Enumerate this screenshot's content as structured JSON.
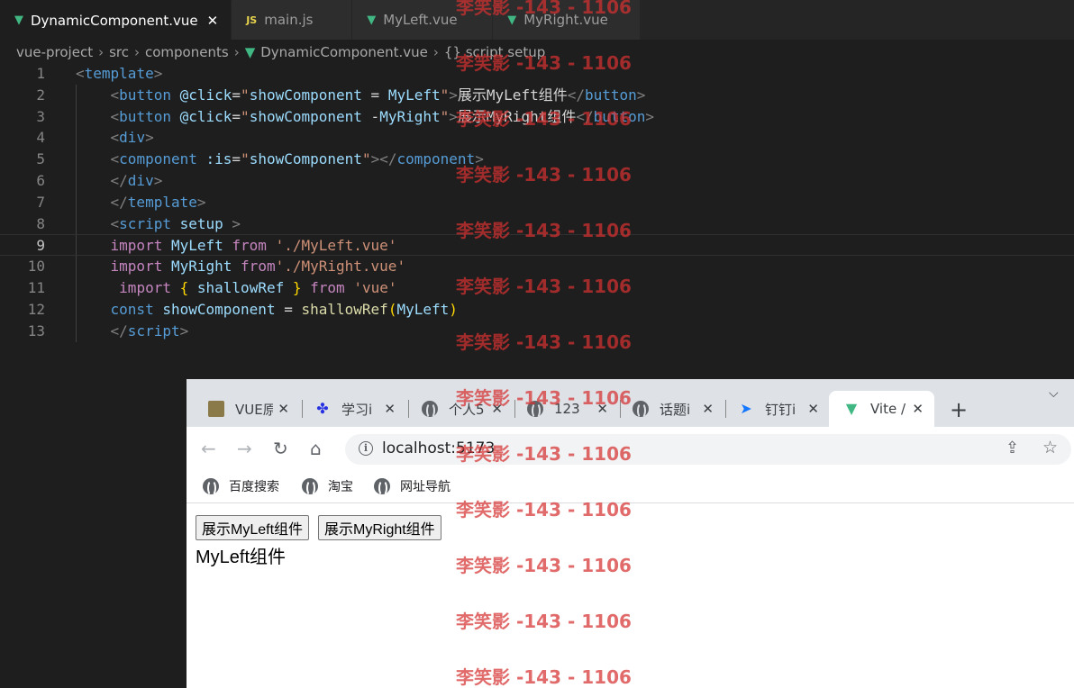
{
  "editor": {
    "tabs": [
      {
        "label": "DynamicComponent.vue",
        "icon": "vue-icon",
        "active": true,
        "close": "✕"
      },
      {
        "label": "main.js",
        "icon": "js-icon",
        "active": false
      },
      {
        "label": "MyLeft.vue",
        "icon": "vue-icon",
        "active": false
      },
      {
        "label": "MyRight.vue",
        "icon": "vue-icon",
        "active": false
      }
    ],
    "js_badge": "JS",
    "breadcrumb": [
      "vue-project",
      "src",
      "components",
      "DynamicComponent.vue",
      "{} script setup"
    ],
    "current_line": 9,
    "lines": [
      {
        "no": "1",
        "tokens": [
          [
            "br",
            "<"
          ],
          [
            "tag",
            "template"
          ],
          [
            "br",
            ">"
          ]
        ]
      },
      {
        "no": "2",
        "tokens": [
          [
            "txt",
            "    "
          ],
          [
            "br",
            "<"
          ],
          [
            "tag",
            "button"
          ],
          [
            "txt",
            " "
          ],
          [
            "attr",
            "@click"
          ],
          [
            "txt",
            "="
          ],
          [
            "str",
            "\""
          ],
          [
            "attr",
            "showComponent"
          ],
          [
            "txt",
            " = "
          ],
          [
            "attr",
            "MyLeft"
          ],
          [
            "str",
            "\""
          ],
          [
            "br",
            ">"
          ],
          [
            "txt",
            "展示MyLeft组件"
          ],
          [
            "br",
            "</"
          ],
          [
            "tag",
            "button"
          ],
          [
            "br",
            ">"
          ]
        ]
      },
      {
        "no": "3",
        "tokens": [
          [
            "txt",
            "    "
          ],
          [
            "br",
            "<"
          ],
          [
            "tag",
            "button"
          ],
          [
            "txt",
            " "
          ],
          [
            "attr",
            "@click"
          ],
          [
            "txt",
            "="
          ],
          [
            "str",
            "\""
          ],
          [
            "attr",
            "showComponent"
          ],
          [
            "txt",
            " -"
          ],
          [
            "attr",
            "MyRight"
          ],
          [
            "str",
            "\""
          ],
          [
            "br",
            ">"
          ],
          [
            "txt",
            "展示MyRight组件"
          ],
          [
            "br",
            "</"
          ],
          [
            "tag",
            "button"
          ],
          [
            "br",
            ">"
          ]
        ]
      },
      {
        "no": "4",
        "tokens": [
          [
            "txt",
            "    "
          ],
          [
            "br",
            "<"
          ],
          [
            "tag",
            "div"
          ],
          [
            "br",
            ">"
          ]
        ]
      },
      {
        "no": "5",
        "tokens": [
          [
            "txt",
            "    "
          ],
          [
            "br",
            "<"
          ],
          [
            "tag",
            "component"
          ],
          [
            "txt",
            " "
          ],
          [
            "attr",
            ":is"
          ],
          [
            "txt",
            "="
          ],
          [
            "str",
            "\""
          ],
          [
            "attr",
            "showComponent"
          ],
          [
            "str",
            "\""
          ],
          [
            "br",
            "></"
          ],
          [
            "tag",
            "component"
          ],
          [
            "br",
            ">"
          ]
        ]
      },
      {
        "no": "6",
        "tokens": [
          [
            "txt",
            "    "
          ],
          [
            "br",
            "</"
          ],
          [
            "tag",
            "div"
          ],
          [
            "br",
            ">"
          ]
        ]
      },
      {
        "no": "7",
        "tokens": [
          [
            "txt",
            "    "
          ],
          [
            "br",
            "</"
          ],
          [
            "tag",
            "template"
          ],
          [
            "br",
            ">"
          ]
        ]
      },
      {
        "no": "8",
        "tokens": [
          [
            "txt",
            "    "
          ],
          [
            "br",
            "<"
          ],
          [
            "tag",
            "script"
          ],
          [
            "txt",
            " "
          ],
          [
            "attr",
            "setup"
          ],
          [
            "txt",
            " "
          ],
          [
            "br",
            ">"
          ]
        ]
      },
      {
        "no": "9",
        "tokens": [
          [
            "txt",
            "    "
          ],
          [
            "kw",
            "import"
          ],
          [
            "txt",
            " "
          ],
          [
            "var",
            "MyLeft"
          ],
          [
            "txt",
            " "
          ],
          [
            "kw",
            "from"
          ],
          [
            "txt",
            " "
          ],
          [
            "str",
            "'./MyLeft.vue'"
          ]
        ]
      },
      {
        "no": "10",
        "tokens": [
          [
            "txt",
            "    "
          ],
          [
            "kw",
            "import"
          ],
          [
            "txt",
            " "
          ],
          [
            "var",
            "MyRight"
          ],
          [
            "txt",
            " "
          ],
          [
            "kw",
            "from"
          ],
          [
            "str",
            "'./MyRight.vue'"
          ]
        ]
      },
      {
        "no": "11",
        "tokens": [
          [
            "txt",
            "     "
          ],
          [
            "kw",
            "import"
          ],
          [
            "txt",
            " "
          ],
          [
            "curly",
            "{"
          ],
          [
            "txt",
            " "
          ],
          [
            "var",
            "shallowRef"
          ],
          [
            "txt",
            " "
          ],
          [
            "curly",
            "}"
          ],
          [
            "txt",
            " "
          ],
          [
            "kw",
            "from"
          ],
          [
            "txt",
            " "
          ],
          [
            "str",
            "'vue'"
          ]
        ]
      },
      {
        "no": "12",
        "tokens": [
          [
            "txt",
            "    "
          ],
          [
            "const",
            "const"
          ],
          [
            "txt",
            " "
          ],
          [
            "var",
            "showComponent"
          ],
          [
            "txt",
            " = "
          ],
          [
            "fn",
            "shallowRef"
          ],
          [
            "curly",
            "("
          ],
          [
            "var",
            "MyLeft"
          ],
          [
            "curly",
            ")"
          ]
        ]
      },
      {
        "no": "13",
        "tokens": [
          [
            "txt",
            "    "
          ],
          [
            "br",
            "</"
          ],
          [
            "tag",
            "script"
          ],
          [
            "br",
            ">"
          ]
        ]
      }
    ]
  },
  "browser": {
    "tabs": [
      {
        "label": "VUE原",
        "icon": "vue-tab-icon"
      },
      {
        "label": "学习i",
        "icon": "baidu-paw-icon"
      },
      {
        "label": "个人5",
        "icon": "globe-icon"
      },
      {
        "label": "123",
        "icon": "globe-icon"
      },
      {
        "label": "话题i",
        "icon": "globe-icon"
      },
      {
        "label": "钉钉i",
        "icon": "dingtalk-icon"
      },
      {
        "label": "Vite /",
        "icon": "vite-vue-icon",
        "active": true
      }
    ],
    "tab_close": "✕",
    "new_tab": "+",
    "tab_menu": "⌵",
    "url": "localhost:5173",
    "bookmarks": [
      "百度搜索",
      "淘宝",
      "网址导航"
    ],
    "page": {
      "buttons": [
        "展示MyLeft组件",
        "展示MyRight组件"
      ],
      "component_text": "MyLeft组件"
    }
  },
  "watermark": {
    "text": "李笑影 -143 - 1106",
    "color": "#d63030",
    "count": 13
  }
}
